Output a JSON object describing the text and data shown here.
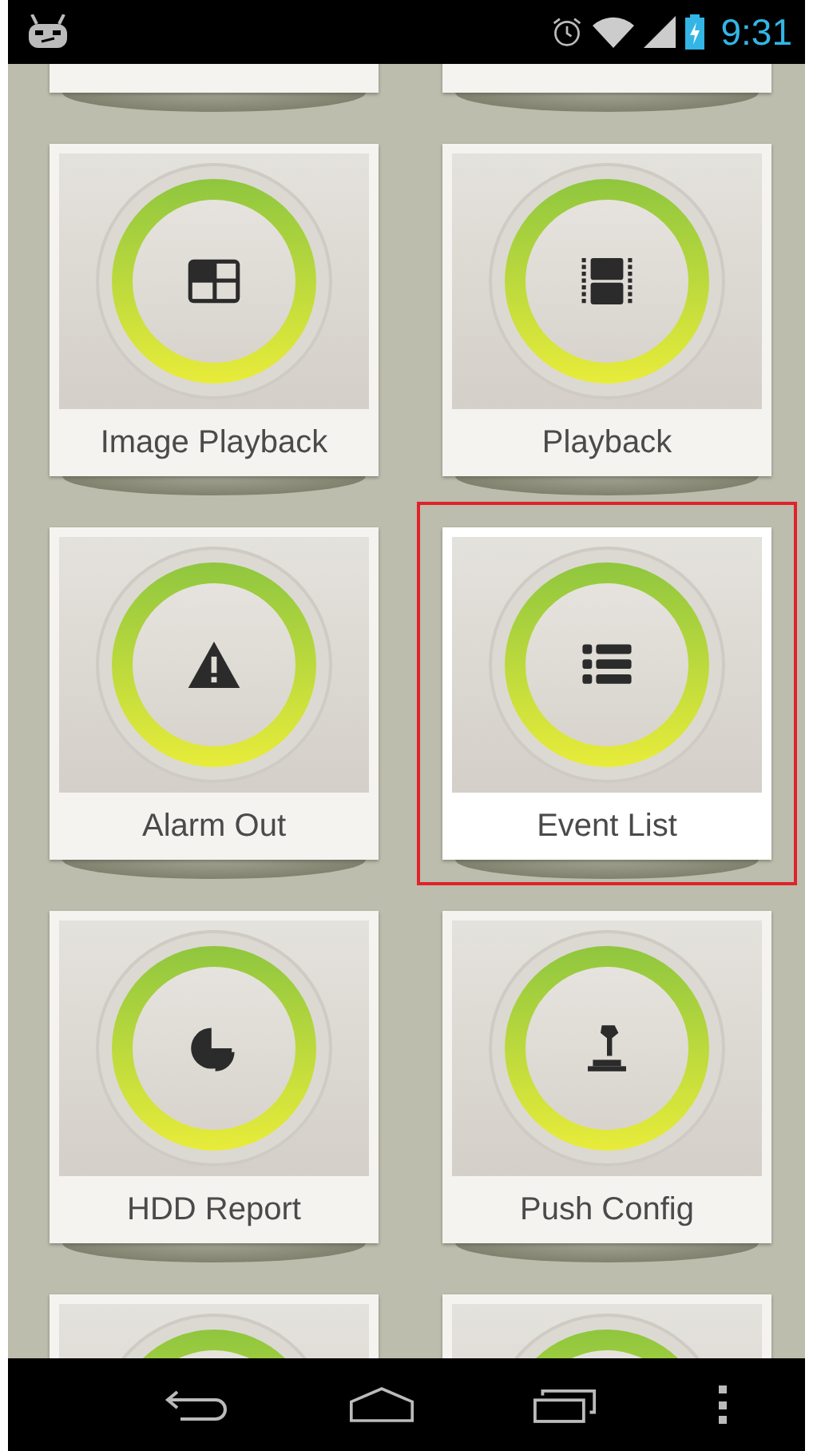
{
  "status_bar": {
    "time": "9:31"
  },
  "tiles": [
    {
      "kind": "none",
      "selected": false
    },
    {
      "kind": "none",
      "selected": false
    },
    {
      "label": "Image Playback",
      "kind": "quad",
      "selected": false
    },
    {
      "label": "Playback",
      "kind": "film",
      "selected": false
    },
    {
      "label": "Alarm Out",
      "kind": "warning",
      "selected": false
    },
    {
      "label": "Event List",
      "kind": "list",
      "selected": true
    },
    {
      "label": "HDD Report",
      "kind": "pie",
      "selected": false
    },
    {
      "label": "Push Config",
      "kind": "press",
      "selected": false
    },
    {
      "kind": "none",
      "selected": false
    },
    {
      "kind": "none",
      "selected": false
    }
  ]
}
